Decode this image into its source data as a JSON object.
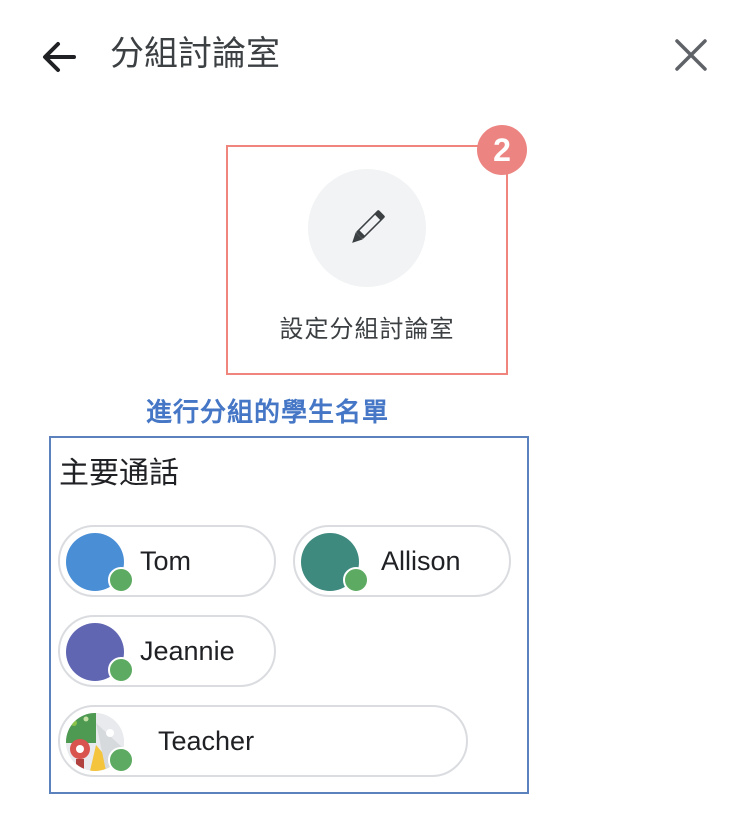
{
  "header": {
    "title": "分組討論室"
  },
  "setup_card": {
    "label": "設定分組討論室",
    "step_badge": "2"
  },
  "annotation": "進行分組的學生名單",
  "group": {
    "title": "主要通話",
    "participants": [
      {
        "name": "Tom",
        "avatar_color": "#4a8fd6"
      },
      {
        "name": "Allison",
        "avatar_color": "#3f8a7f"
      },
      {
        "name": "Jeannie",
        "avatar_color": "#6166b3"
      },
      {
        "name": "Teacher",
        "avatar_color": "#e8eaed"
      }
    ]
  },
  "colors": {
    "highlight_border": "#ef857c",
    "badge": "#ec8582",
    "annotation": "#4577c6",
    "group_border": "#5b82bd",
    "online_status": "#5dab62"
  }
}
